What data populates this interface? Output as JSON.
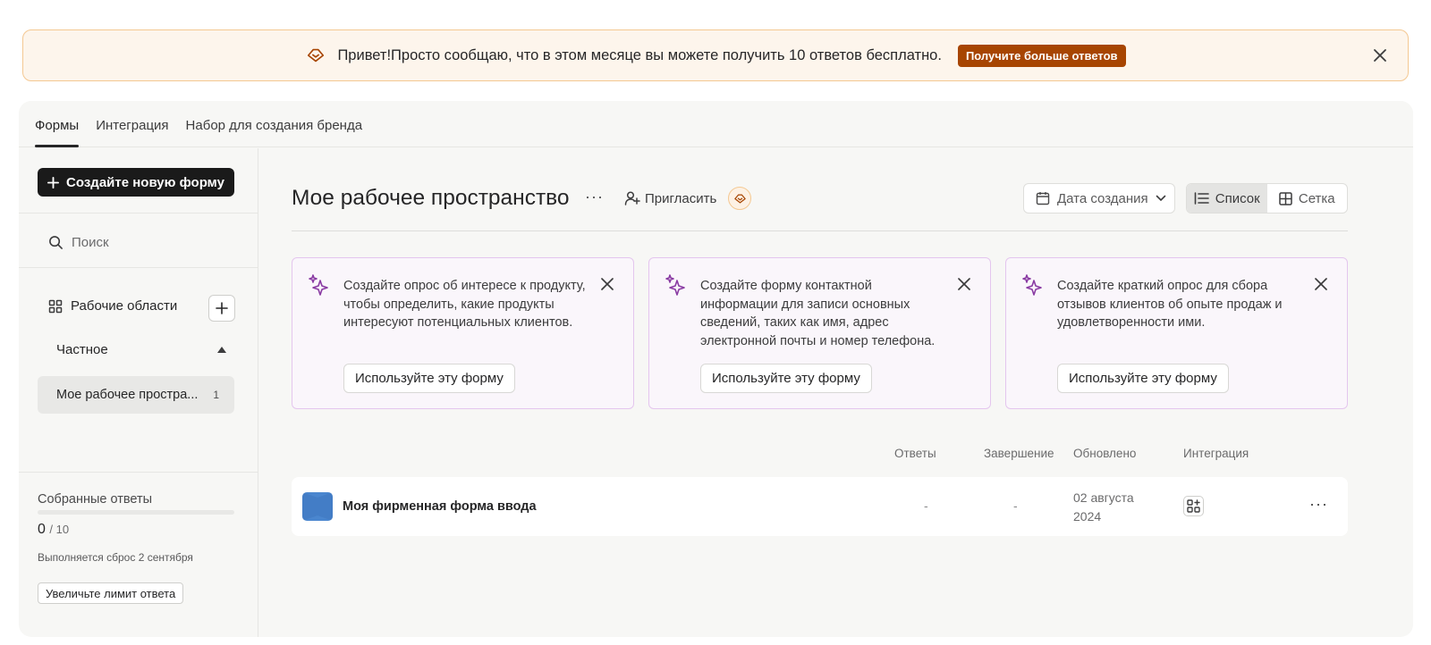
{
  "banner": {
    "text": "Привет!Просто сообщаю, что в этом месяце вы можете получить 10 ответов бесплатно.",
    "cta_label": "Получите больше ответов",
    "accent_color": "#a74502"
  },
  "tabs": [
    {
      "label": "Формы",
      "active": true
    },
    {
      "label": "Интеграция",
      "active": false
    },
    {
      "label": "Набор для создания бренда",
      "active": false
    }
  ],
  "sidebar": {
    "create_label": "Создайте новую форму",
    "search_placeholder": "Поиск",
    "workspaces_label": "Рабочие области",
    "private_label": "Частное",
    "workspace_item": {
      "label": "Мое рабочее простра...",
      "count": "1"
    },
    "collected_label": "Собранные ответы",
    "collected_count": "0",
    "collected_max": "/ 10",
    "collected_fraction": 0,
    "reset_text": "Выполняется сброс 2 сентября",
    "limit_button": "Увеличьте лимит ответа"
  },
  "main": {
    "title": "Мое рабочее пространство",
    "more_label": "···",
    "invite_label": "Пригласить",
    "sort_label": "Дата создания",
    "view_list_label": "Список",
    "view_grid_label": "Сетка",
    "cards": [
      {
        "text": "Создайте опрос об интересе к продукту, чтобы определить, какие продукты интересуют потенциальных клиентов.",
        "button": "Используйте эту форму"
      },
      {
        "text": "Создайте форму контактной информации для записи основных сведений, таких как имя, адрес электронной почты и номер телефона.",
        "button": "Используйте эту форму"
      },
      {
        "text": "Создайте краткий опрос для сбора отзывов клиентов об опыте продаж и удовлетворенности ими.",
        "button": "Используйте эту форму"
      }
    ],
    "columns": {
      "responses": "Ответы",
      "completion": "Завершение",
      "updated": "Обновлено",
      "integration": "Интеграция"
    },
    "rows": [
      {
        "name": "Моя фирменная форма ввода",
        "responses": "-",
        "completion": "-",
        "updated": "02 августа 2024",
        "thumb_color": "#4a86cf"
      }
    ],
    "row_more_label": "···"
  }
}
